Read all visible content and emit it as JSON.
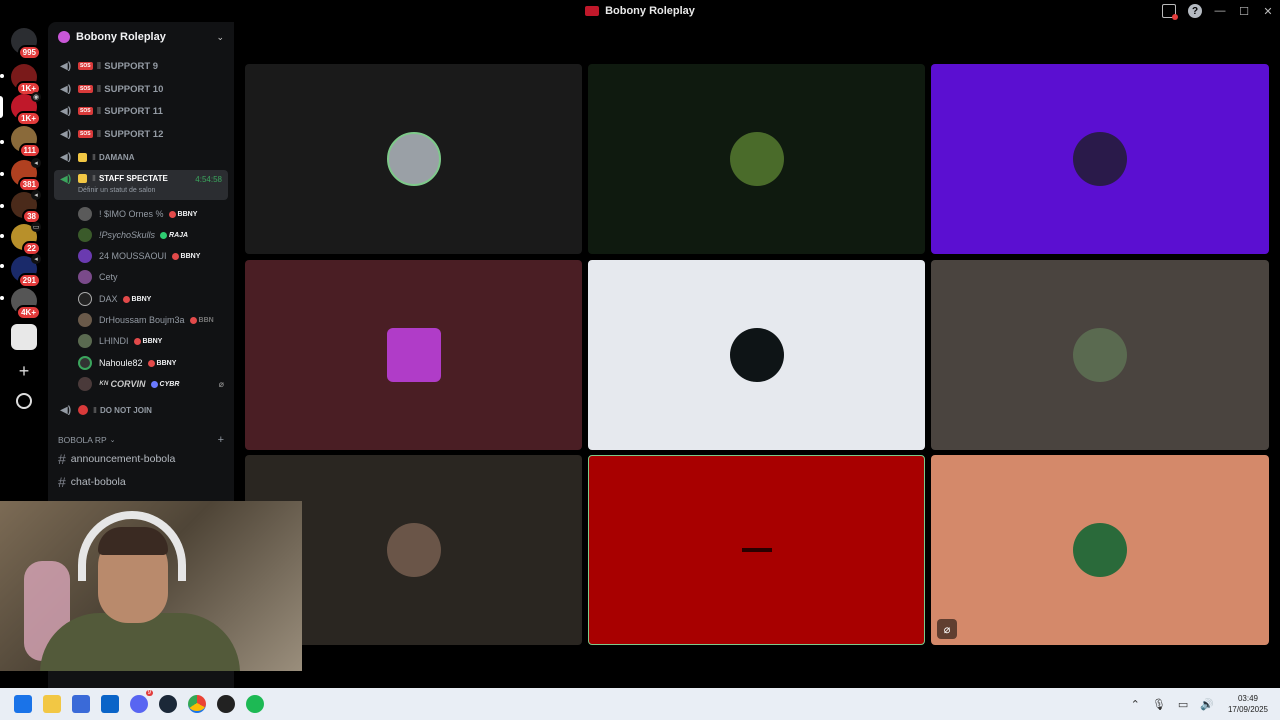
{
  "window": {
    "title": "Bobony Roleplay"
  },
  "rail": {
    "badges": [
      "995",
      "1K+",
      "1K+",
      "111",
      "381",
      "38",
      "22",
      "291",
      "4K+"
    ]
  },
  "server": {
    "name": "Bobony Roleplay"
  },
  "channels": [
    {
      "name": "SUPPORT 9",
      "sep": "Ⅱ"
    },
    {
      "name": "SUPPORT 10",
      "sep": "Ⅱ"
    },
    {
      "name": "SUPPORT 11",
      "sep": "Ⅱ"
    },
    {
      "name": "SUPPORT 12",
      "sep": "Ⅱ"
    },
    {
      "name": "DAMANA",
      "sep": "Ⅱ"
    }
  ],
  "active_channel": {
    "name": "STAFF SPECTATE",
    "sep": "Ⅱ",
    "timer": "4:54:58",
    "status_hint": "Définir un statut de salon"
  },
  "members": [
    {
      "name": "! $IMO Ornes %",
      "tag": "BBNY"
    },
    {
      "name": "!PsychoSkulls",
      "tag": "RAJA"
    },
    {
      "name": "24 MOUSSAOUI",
      "tag": "BBNY"
    },
    {
      "name": "Cety",
      "tag": ""
    },
    {
      "name": "DAX",
      "tag": "BBNY"
    },
    {
      "name": "DrHoussam Boujm3a",
      "tag": "BBN"
    },
    {
      "name": "LHINDI",
      "tag": "BBNY"
    },
    {
      "name": "Nahoule82",
      "tag": "BBNY"
    },
    {
      "name": "ᴷᴺ CORVIN",
      "tag": "CYBR"
    }
  ],
  "last_channel": {
    "name": "DO NOT JOIN",
    "sep": "Ⅱ"
  },
  "category": {
    "name": "BOBOLA RP"
  },
  "text_channels": [
    "announcement-bobola",
    "chat-bobola"
  ],
  "tiles": [
    {
      "bg": "#1a1a1a",
      "avatar": "#9aa0a6"
    },
    {
      "bg": "#0f1a0f",
      "avatar": "#4a6b2a"
    },
    {
      "bg": "#5b0fd1",
      "avatar": "#2a1a4a"
    },
    {
      "bg": "#4a1e24",
      "avatar": "#b03cc8"
    },
    {
      "bg": "#e6e9ee",
      "avatar": "#0e1416"
    },
    {
      "bg": "#4a443f",
      "avatar": "#5a6a50"
    },
    {
      "bg": "#2a2621",
      "avatar": "#6a5548"
    },
    {
      "bg": "#a80000",
      "avatar": ""
    },
    {
      "bg": "#d4896a",
      "avatar": "#2a6a3a"
    }
  ],
  "taskbar": {
    "time": "03:49",
    "date": "17/09/2025",
    "icons": [
      "windows-start-icon",
      "file-explorer-icon",
      "store-icon",
      "outlook-icon",
      "discord-icon",
      "steam-icon",
      "chrome-icon",
      "app-icon",
      "spotify-icon"
    ]
  },
  "colors": {
    "accent_green": "#3ba55d",
    "badge_red": "#e23b3b",
    "speaking_border": "#7ec98a"
  }
}
